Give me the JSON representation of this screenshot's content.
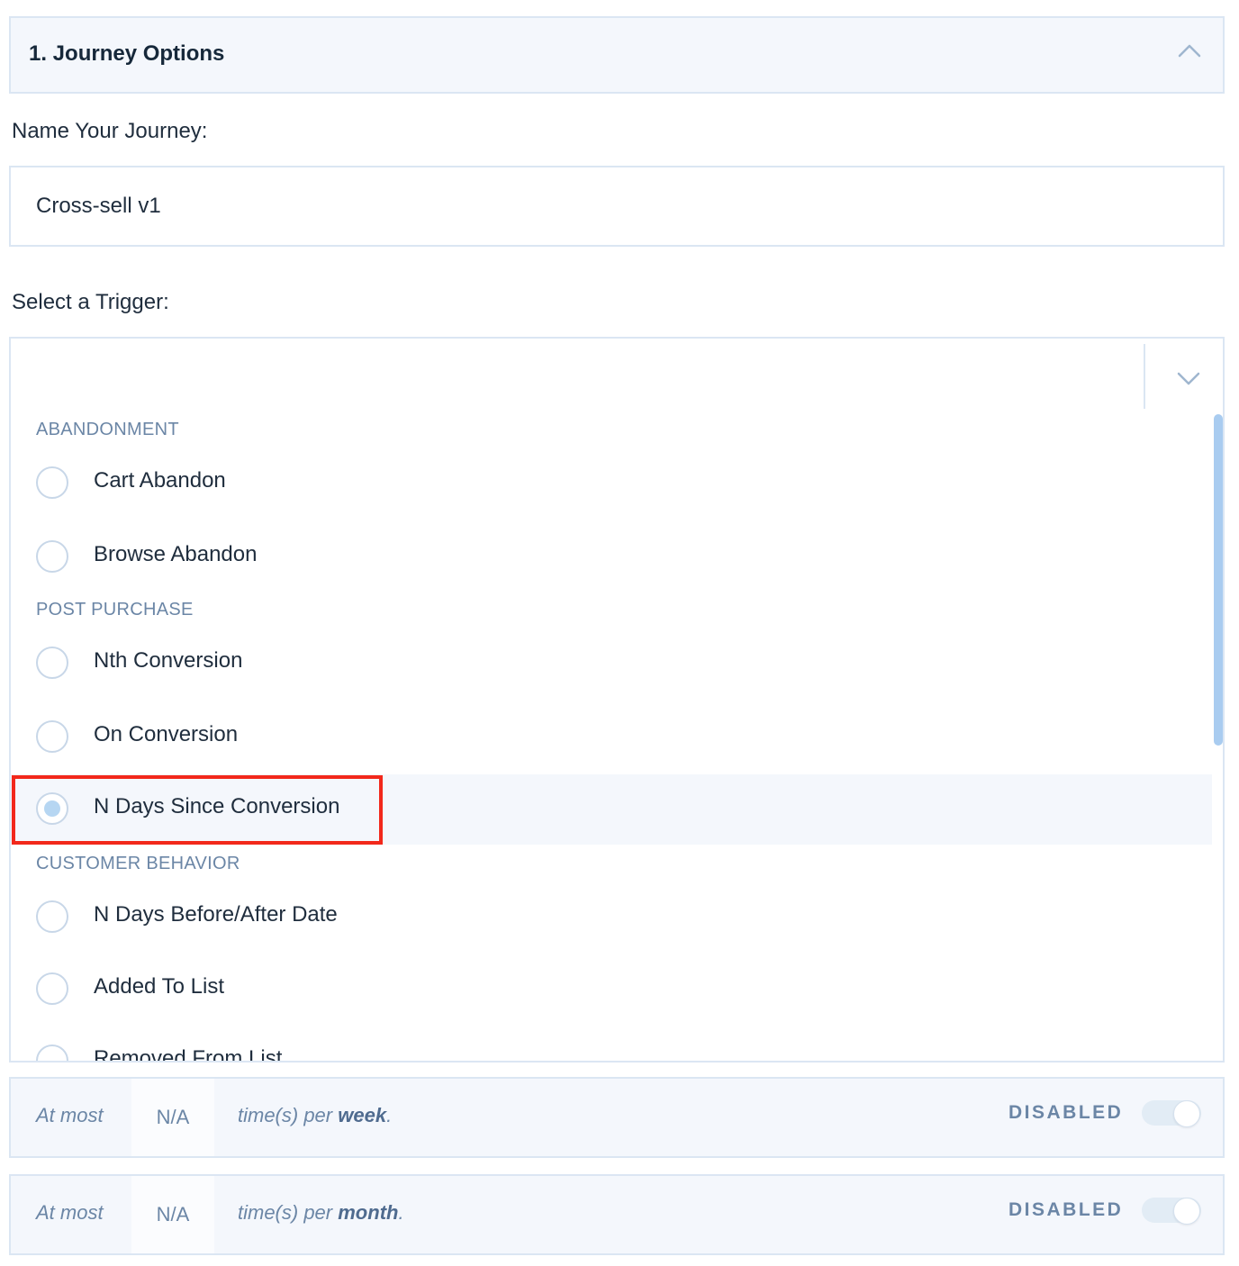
{
  "section": {
    "title": "1. Journey Options",
    "collapse_icon": "chevron-up-icon"
  },
  "name_field": {
    "label": "Name Your Journey:",
    "value": "Cross-sell v1"
  },
  "trigger": {
    "label": "Select a Trigger:",
    "dropdown_icon": "chevron-down-icon",
    "groups": [
      {
        "label": "ABANDONMENT",
        "options": [
          "Cart Abandon",
          "Browse Abandon"
        ]
      },
      {
        "label": "POST PURCHASE",
        "options": [
          "Nth Conversion",
          "On Conversion",
          "N Days Since Conversion"
        ]
      },
      {
        "label": "CUSTOMER BEHAVIOR",
        "options": [
          "N Days Before/After Date",
          "Added To List",
          "Removed From List"
        ]
      }
    ],
    "selected": "N Days Since Conversion"
  },
  "limits": [
    {
      "prefix": "At most",
      "value": "N/A",
      "text": "time(s) per ",
      "period": "week",
      "suffix": ".",
      "status": "DISABLED"
    },
    {
      "prefix": "At most",
      "value": "N/A",
      "text": "time(s) per ",
      "period": "month",
      "suffix": ".",
      "status": "DISABLED"
    }
  ],
  "colors": {
    "accent": "#b6d6f2",
    "highlight": "#f2281b",
    "muted": "#6b86a6",
    "border": "#dbe6f3"
  }
}
